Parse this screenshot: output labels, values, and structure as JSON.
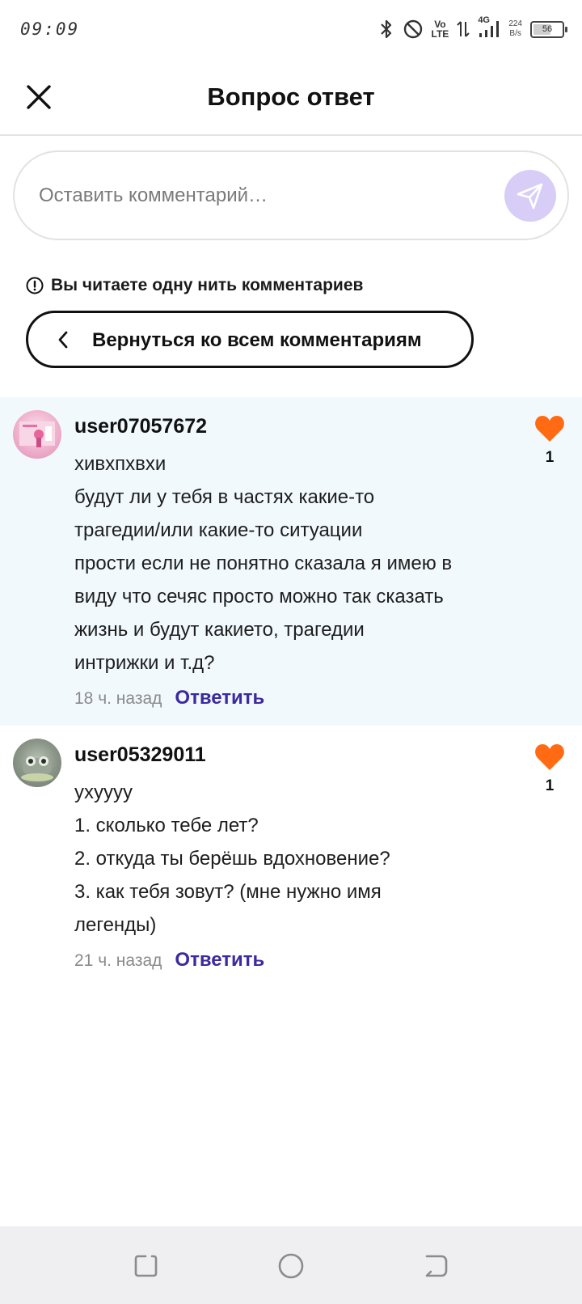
{
  "status_bar": {
    "time": "09:09",
    "network_type": "4G",
    "volte_top": "Vo",
    "volte_bottom": "LTE",
    "net_speed_value": "224",
    "net_speed_unit": "B/s",
    "battery_level": "56",
    "icons": [
      "bluetooth-icon",
      "do-not-disturb-icon",
      "volte-icon",
      "data-transfer-icon",
      "signal-icon",
      "battery-icon"
    ]
  },
  "header": {
    "title": "Вопрос ответ",
    "close_icon": "close-icon"
  },
  "comment_input": {
    "placeholder": "Оставить комментарий…",
    "send_icon": "send-icon",
    "send_color": "#d8cdf7"
  },
  "thread": {
    "notice": "Вы читаете одну нить комментариев",
    "notice_icon": "info-icon",
    "back_label": "Вернуться ко всем комментариям",
    "back_icon": "chevron-left-icon"
  },
  "comments": [
    {
      "username": "user07057672",
      "lines": [
        "хивхпхвхи",
        "будут ли у тебя в частях какие-то",
        "трагедии/или какие-то ситуации",
        "прости если не понятно сказала я имею в",
        "виду что сечяс просто можно так сказать",
        "жизнь и будут какието, трагедии",
        "интрижки и т.д?"
      ],
      "time": "18 ч. назад",
      "reply_label": "Ответить",
      "likes": "1",
      "highlighted": true
    },
    {
      "username": "user05329011",
      "lines": [
        "ухуууу",
        "1. сколько тебе лет?",
        "2. откуда ты берёшь вдохновение?",
        "3. как тебя зовут? (мне нужно имя",
        "легенды)"
      ],
      "time": "21 ч. назад",
      "reply_label": "Ответить",
      "likes": "1",
      "highlighted": false
    }
  ],
  "colors": {
    "accent": "#3c2a9e",
    "like": "#ff6a13",
    "highlight_bg": "#f1f9fd"
  },
  "nav_bar": {
    "icons": [
      "recents-icon",
      "home-icon",
      "back-icon"
    ]
  }
}
